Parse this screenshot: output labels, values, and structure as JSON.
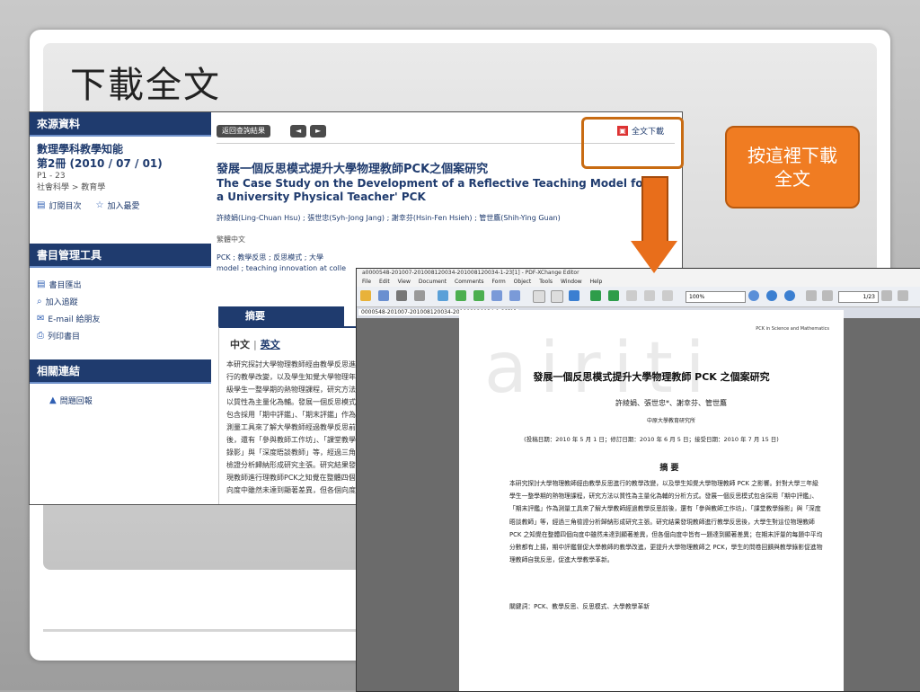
{
  "slide": {
    "title": "下載全文",
    "callout": "按這裡下載全文"
  },
  "web": {
    "sidebar": {
      "source_heading": "來源資料",
      "journal": "數理學科教學知能",
      "issue": "第2冊 (2010 / 07 / 01)",
      "pages": "P1 - 23",
      "category": "社會科學 > 教育學",
      "toc_link": "訂閱目次",
      "fav_link": "加入最愛",
      "tools_heading": "書目管理工具",
      "tools": [
        "書目匯出",
        "加入追蹤",
        "E-mail 給朋友",
        "列印書目"
      ],
      "related_heading": "相關連結",
      "related": [
        "問題回報"
      ]
    },
    "main": {
      "back_button": "返回查詢結果",
      "nav_prev": "◄",
      "nav_next": "►",
      "download_label": "全文下載",
      "title_zh": "發展一個反思模式提升大學物理教師PCK之個案研究",
      "title_en": "The Case Study on the Development of a Reflective Teaching Model for a University Physical Teacher' PCK",
      "authors": "許綾娟(Ling-Chuan Hsu) ; 張世忠(Syh-Jong Jang) ; 謝幸芬(Hsin-Fen Hsieh) ; 管世鷹(Shih-Ying Guan)",
      "language": "繁體中文",
      "keywords": "PCK ; 教學反思 ; 反思模式 ; 大學",
      "keywords2": "model ; teaching innovation at colle",
      "abstract_tab": "摘要",
      "abstract_lang_zh": "中文",
      "abstract_lang_sep": "|",
      "abstract_lang_en": "英文",
      "abstract_text": "本研究探討大學物理教師經由教學反思進行的教學改變，以及學生知覺大學物理年級學生一整學期的熱物理課程，研究方法以質性為主量化為輔。發展一個反思模式包含採用「期中評鑑」、「期末評鑑」作為測量工具來了解大學教師經過教學反思前後，還有「參與教師工作坊」、「課堂教學錄影」與「深度晤談教師」等，經過三角檢證分析歸納形成研究主張。研究結果發現教師進行理教師PCK之知覺在整體四個向度中雖然未達到顯著差異，但各個向度中皆有一顯達到顯著差異；在期末評量的每題中平均分數都有上揚，期中評鑑督促大學教師的教學改進，更提升大學物理教師之PCK，學生的問卷回饋與教學錄影促進物理教師自我反思，促進大學教學革新。"
    }
  },
  "pdf": {
    "window_title": "a0000548-201007-201008120034-201008120034-1-23[1] - PDF-XChange Editor",
    "menu": [
      "File",
      "Edit",
      "View",
      "Document",
      "Comments",
      "Form",
      "Object",
      "Tools",
      "Window",
      "Help"
    ],
    "zoom": "100%",
    "page": "1/23",
    "tab": "0000548-201007-201008120034-201008120034-1-23[1]",
    "tab_close": "×",
    "tab_add": "+",
    "page_header": "PCK in Science and Mathematics",
    "watermark": "airiti",
    "title": "發展一個反思模式提升大學物理教師 PCK 之個案研究",
    "authors": "許綾娟、張世忠*、謝幸芬、管世鷹",
    "dept": "中原大學教育研究所",
    "dates": "(投稿日期：2010 年 5 月 1 日；修訂日期：2010 年 6 月 5 日；接受日期：2010 年 7 月 15 日)",
    "abstract_heading": "摘 要",
    "abstract": "本研究探討大學物理教師經由教學反思進行的教學改變，以及學生知覺大學物理教師 PCK 之影響。針對大學三年級學生一整學期的熱物理課程，研究方法以質性為主量化為輔的分析方式。發展一個反思模式包含採用「期中評鑑」、「期末評鑑」作為測量工具來了解大學教師經過教學反思前後，還有「參與教師工作坊」、「課堂教學錄影」與「深度晤談教師」等，經過三角檢證分析歸納形成研究主張。研究結果發現教師進行教學反思後，大學生對這位物理教師 PCK 之知覺在整體四個向度中雖然未達到顯著差異，但各個向度中皆有一題達到顯著差異；在期末評量的每題中平均分數都有上揚，期中評鑑督促大學教師的教學改進，更提升大學物理教師之 PCK，學生的問卷回饋與教學錄影促進物理教師自我反思，促進大學教學革新。",
    "keywords": "關鍵詞：PCK、教學反思、反思模式、大學教學革新"
  }
}
